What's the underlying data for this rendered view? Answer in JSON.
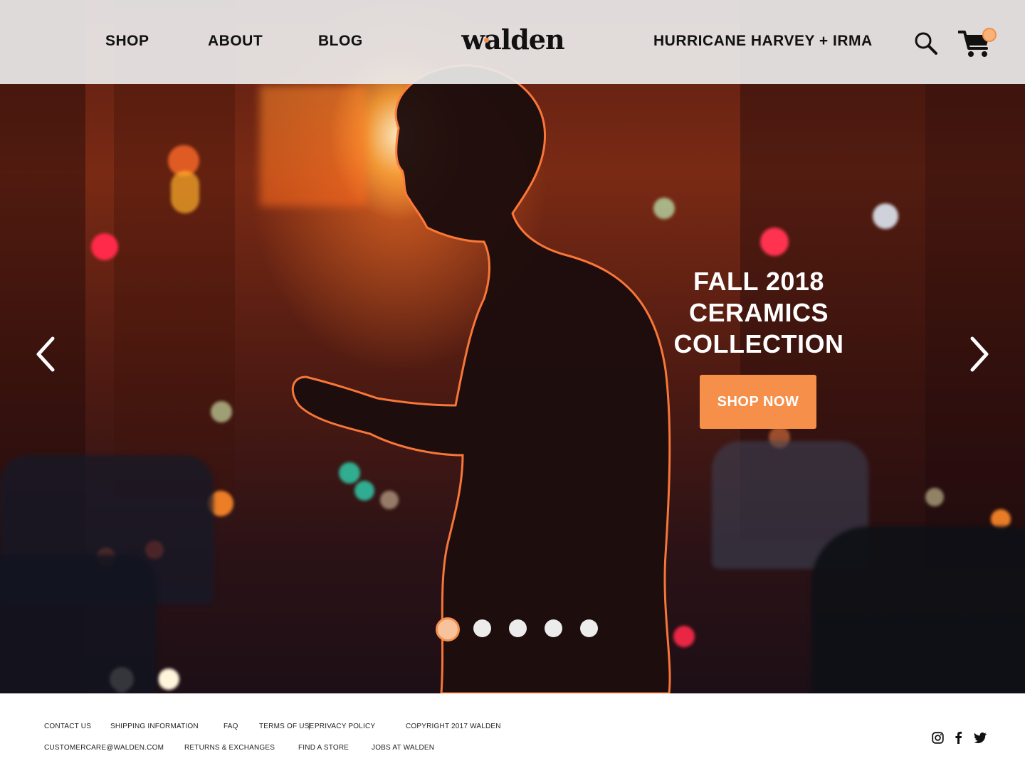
{
  "nav": {
    "shop": "SHOP",
    "about": "ABOUT",
    "blog": "BLOG",
    "logo": "walden",
    "hurricane": "HURRICANE HARVEY + IRMA",
    "search_icon": "search-icon",
    "cart_icon": "cart-icon"
  },
  "hero": {
    "title_line1": "FALL 2018",
    "title_line2": "CERAMICS",
    "title_line3": "COLLECTION",
    "cta": "SHOP NOW",
    "prev_icon": "chevron-left-icon",
    "next_icon": "chevron-right-icon",
    "slide_count": 5,
    "active_slide": 1
  },
  "footer": {
    "contact": "CONTACT US",
    "shipping": "SHIPPING INFORMATION",
    "faq": "FAQ",
    "terms": "TERMS OF USE",
    "separator": "|",
    "privacy": "PRIVACY POLICY",
    "copyright": "COPYRIGHT 2017 WALDEN",
    "email": "CUSTOMERCARE@WALDEN.COM",
    "returns": "RETURNS & EXCHANGES",
    "find_store": "FIND A STORE",
    "jobs": "JOBS AT WALDEN",
    "social_icons": [
      "instagram-icon",
      "facebook-icon",
      "twitter-icon"
    ]
  },
  "colors": {
    "accent": "#f58f4a",
    "header_bg": "#ebe9ea",
    "text_dark": "#111111"
  }
}
